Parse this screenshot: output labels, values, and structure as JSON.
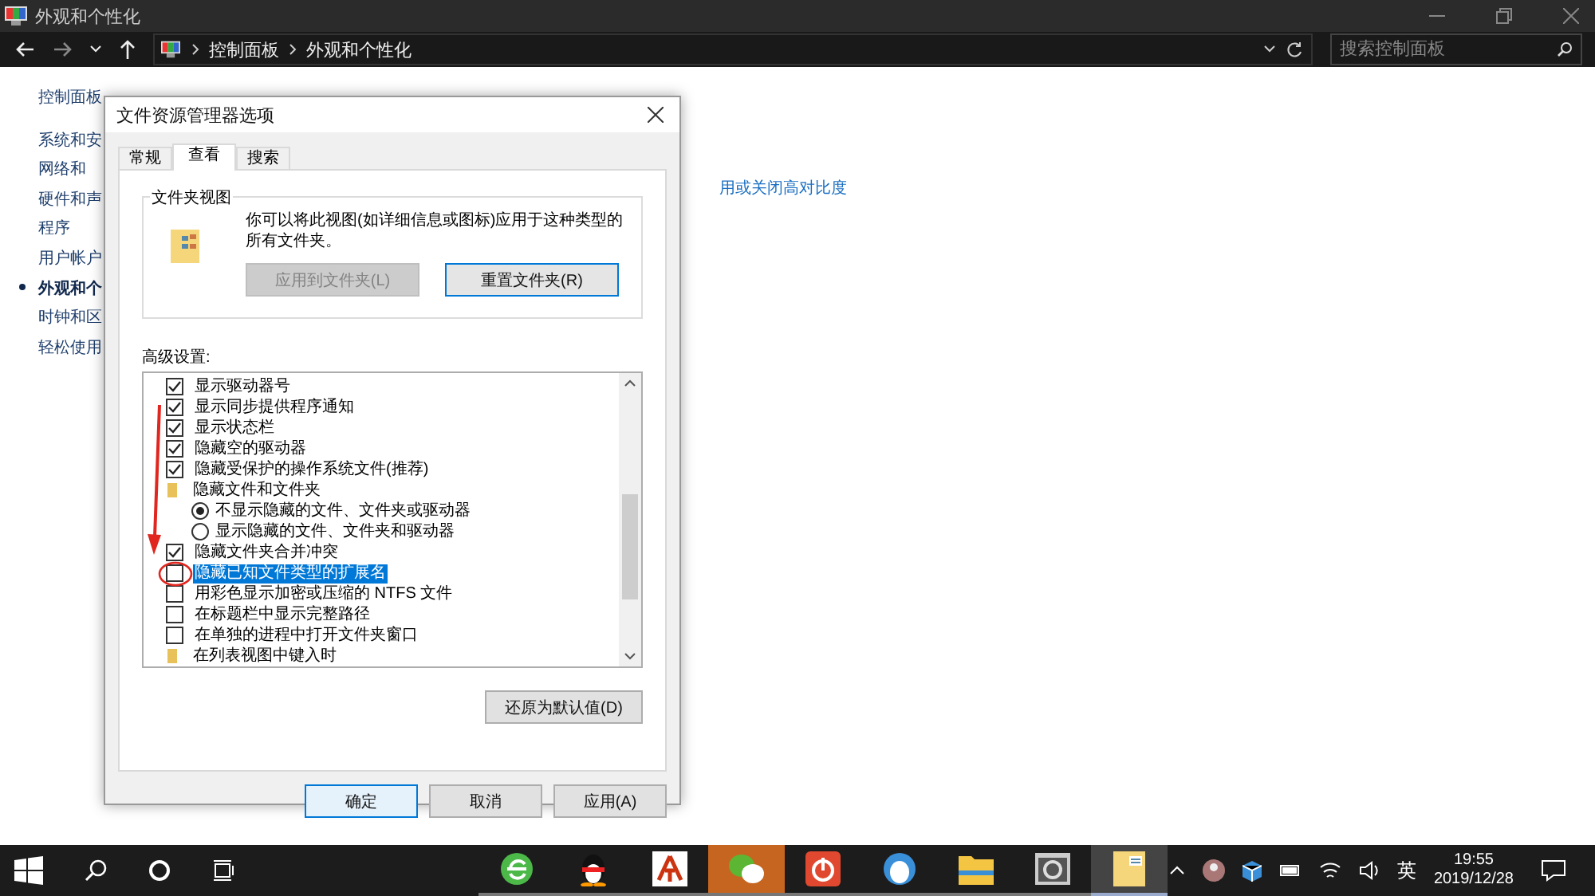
{
  "explorer": {
    "title": "外观和个性化",
    "breadcrumb": [
      "控制面板",
      "外观和个性化"
    ],
    "search": {
      "placeholder": "搜索控制面板"
    },
    "sidebar": {
      "items": [
        {
          "label": "控制面板",
          "selected": false
        },
        {
          "label": "系统和安",
          "selected": false
        },
        {
          "label": "网络和",
          "selected": false
        },
        {
          "label": "硬件和声",
          "selected": false
        },
        {
          "label": "程序",
          "selected": false
        },
        {
          "label": "用户帐户",
          "selected": false
        },
        {
          "label": "外观和个",
          "selected": true
        },
        {
          "label": "时钟和区",
          "selected": false
        },
        {
          "label": "轻松使用",
          "selected": false
        }
      ]
    },
    "link": "用或关闭高对比度"
  },
  "dialog": {
    "title": "文件资源管理器选项",
    "tabs": [
      {
        "label": "常规",
        "selected": false
      },
      {
        "label": "查看",
        "selected": true
      },
      {
        "label": "搜索",
        "selected": false
      }
    ],
    "folder_views": {
      "title": "文件夹视图",
      "text": "你可以将此视图(如详细信息或图标)应用于这种类型的所有文件夹。",
      "buttons": [
        {
          "label": "应用到文件夹(L)",
          "disabled": true
        },
        {
          "label": "重置文件夹(R)",
          "disabled": false
        }
      ]
    },
    "advanced": {
      "label": "高级设置:",
      "items": [
        {
          "kind": "checkbox",
          "label": "显示驱动器号",
          "checked": true,
          "selected": false
        },
        {
          "kind": "checkbox",
          "label": "显示同步提供程序通知",
          "checked": true,
          "selected": false
        },
        {
          "kind": "checkbox",
          "label": "显示状态栏",
          "checked": true,
          "selected": false
        },
        {
          "kind": "checkbox",
          "label": "隐藏空的驱动器",
          "checked": true,
          "selected": false
        },
        {
          "kind": "checkbox",
          "label": "隐藏受保护的操作系统文件(推荐)",
          "checked": true,
          "selected": false
        },
        {
          "kind": "folder",
          "label": "隐藏文件和文件夹",
          "selected": false,
          "children": [
            {
              "kind": "radio",
              "label": "不显示隐藏的文件、文件夹或驱动器",
              "selected": true
            },
            {
              "kind": "radio",
              "label": "显示隐藏的文件、文件夹和驱动器",
              "selected": false
            }
          ]
        },
        {
          "kind": "checkbox",
          "label": "隐藏文件夹合并冲突",
          "checked": true,
          "selected": false
        },
        {
          "kind": "checkbox",
          "label": "隐藏已知文件类型的扩展名",
          "checked": false,
          "selected": true
        },
        {
          "kind": "checkbox",
          "label": "用彩色显示加密或压缩的 NTFS 文件",
          "checked": false,
          "selected": false
        },
        {
          "kind": "checkbox",
          "label": "在标题栏中显示完整路径",
          "checked": false,
          "selected": false
        },
        {
          "kind": "checkbox",
          "label": "在单独的进程中打开文件夹窗口",
          "checked": false,
          "selected": false
        },
        {
          "kind": "folder",
          "label": "在列表视图中键入时",
          "selected": false
        }
      ]
    },
    "restore_button": "还原为默认值(D)",
    "buttons": [
      {
        "label": "确定",
        "default": true
      },
      {
        "label": "取消",
        "default": false
      },
      {
        "label": "应用(A)",
        "default": false
      }
    ]
  },
  "taskbar": {
    "apps": [
      {
        "kind": "browser",
        "flashing": false,
        "active": false
      },
      {
        "kind": "penguin",
        "flashing": false,
        "active": false
      },
      {
        "kind": "red-app",
        "flashing": false,
        "active": false
      },
      {
        "kind": "chat",
        "flashing": true,
        "active": false
      },
      {
        "kind": "power",
        "flashing": false,
        "active": false
      },
      {
        "kind": "mascot",
        "flashing": false,
        "active": false
      },
      {
        "kind": "folder",
        "flashing": false,
        "active": false
      },
      {
        "kind": "settings",
        "flashing": false,
        "active": false
      },
      {
        "kind": "notes",
        "flashing": false,
        "active": true
      }
    ],
    "language": "英",
    "time": "19:55",
    "date": "2019/12/28"
  }
}
